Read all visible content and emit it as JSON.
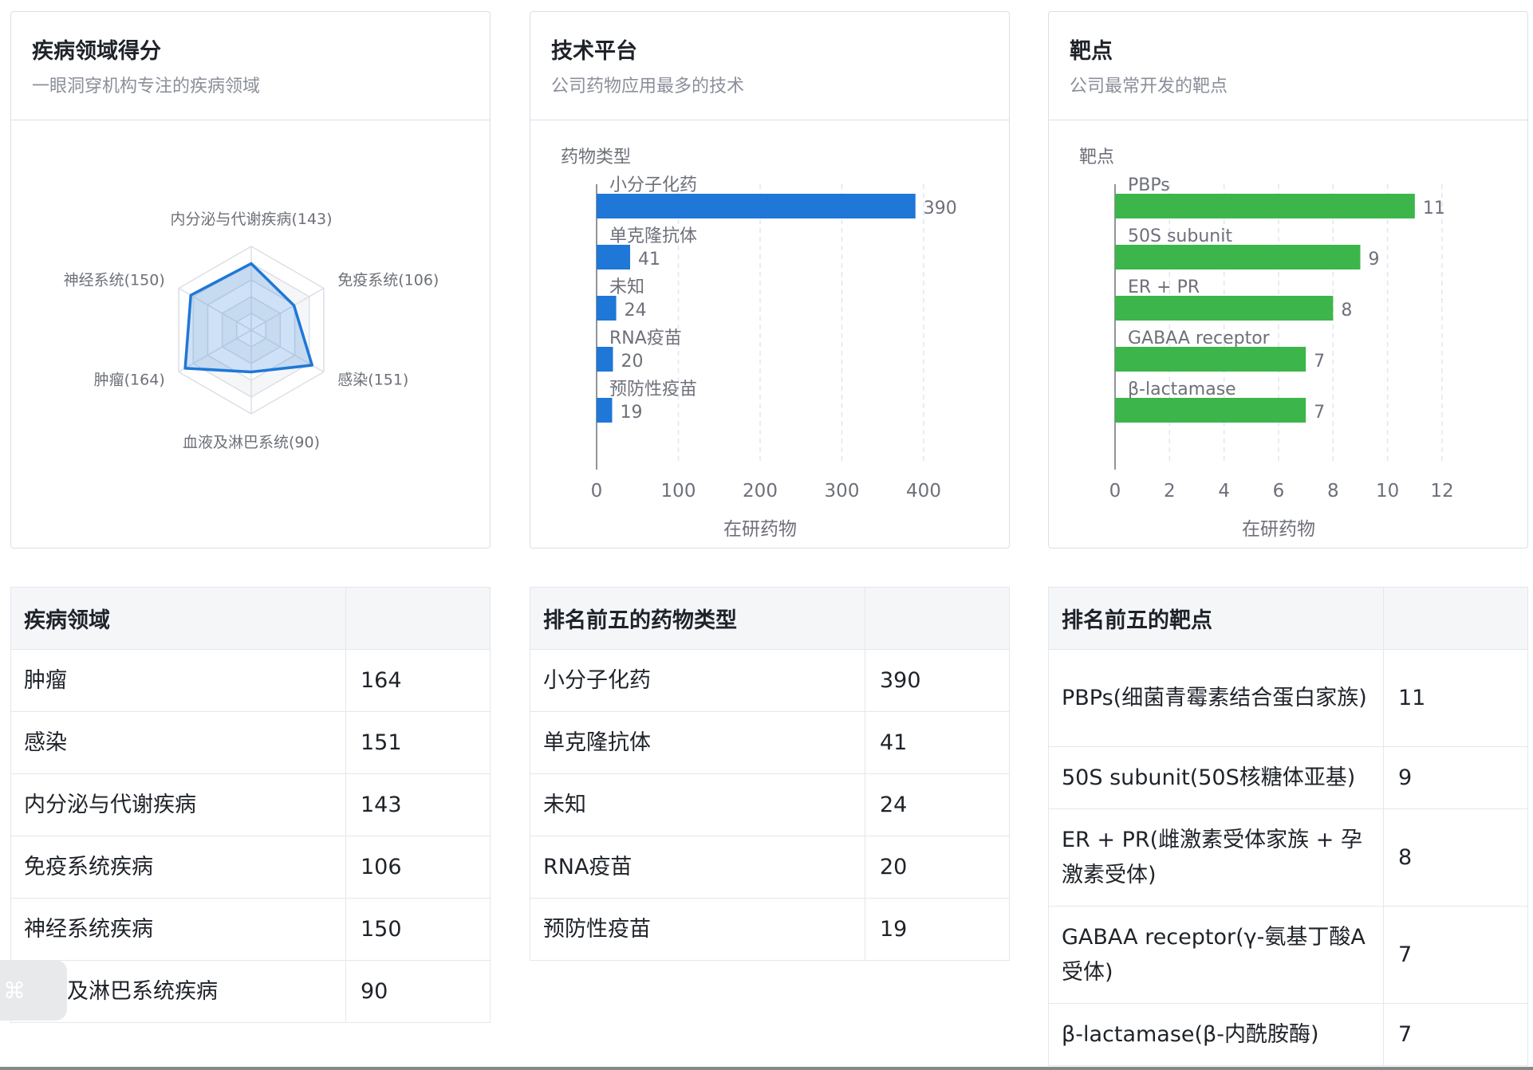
{
  "cards": [
    {
      "title": "疾病领域得分",
      "subtitle": "一眼洞穿机构专注的疾病领域"
    },
    {
      "title": "技术平台",
      "subtitle": "公司药物应用最多的技术"
    },
    {
      "title": "靶点",
      "subtitle": "公司最常开发的靶点"
    }
  ],
  "chart_data": [
    {
      "type": "radar",
      "indicators": [
        {
          "label": "内分泌与代谢疾病(143)",
          "value": 143
        },
        {
          "label": "免疫系统(106)",
          "value": 106
        },
        {
          "label": "感染(151)",
          "value": 151
        },
        {
          "label": "血液及淋巴系统(90)",
          "value": 90
        },
        {
          "label": "肿瘤(164)",
          "value": 164
        },
        {
          "label": "神经系统(150)",
          "value": 150
        }
      ],
      "max": 180,
      "rings": 5,
      "color": "#1f77d8",
      "fill": "rgba(31,119,216,0.22)"
    },
    {
      "type": "bar",
      "orientation": "horizontal",
      "ylabel": "药物类型",
      "xlabel": "在研药物",
      "categories": [
        "小分子化药",
        "单克隆抗体",
        "未知",
        "RNA疫苗",
        "预防性疫苗"
      ],
      "values": [
        390,
        41,
        24,
        20,
        19
      ],
      "xlim": [
        0,
        400
      ],
      "xticks": [
        "0",
        "100",
        "200",
        "300",
        "400"
      ],
      "grid": "dashed-vertical",
      "color": "#1f77d8"
    },
    {
      "type": "bar",
      "orientation": "horizontal",
      "ylabel": "靶点",
      "xlabel": "在研药物",
      "categories": [
        "PBPs",
        "50S subunit",
        "ER + PR",
        "GABAA receptor",
        "β-lactamase"
      ],
      "values": [
        11,
        9,
        8,
        7,
        7
      ],
      "xlim": [
        0,
        12
      ],
      "xticks": [
        "0",
        "2",
        "4",
        "6",
        "8",
        "10",
        "12"
      ],
      "grid": "dashed-vertical",
      "color": "#3cb54a"
    }
  ],
  "tables": [
    {
      "header": "疾病领域",
      "rows": [
        {
          "name": "肿瘤",
          "value": "164"
        },
        {
          "name": "感染",
          "value": "151"
        },
        {
          "name": "内分泌与代谢疾病",
          "value": "143"
        },
        {
          "name": "免疫系统疾病",
          "value": "106"
        },
        {
          "name": "神经系统疾病",
          "value": "150"
        },
        {
          "name": "血液及淋巴系统疾病",
          "value": "90"
        }
      ]
    },
    {
      "header": "排名前五的药物类型",
      "rows": [
        {
          "name": "小分子化药",
          "value": "390"
        },
        {
          "name": "单克隆抗体",
          "value": "41"
        },
        {
          "name": "未知",
          "value": "24"
        },
        {
          "name": "RNA疫苗",
          "value": "20"
        },
        {
          "name": "预防性疫苗",
          "value": "19"
        }
      ]
    },
    {
      "header": "排名前五的靶点",
      "rows": [
        {
          "name": "PBPs(细菌青霉素结合蛋白家族)",
          "value": "11"
        },
        {
          "name": "50S subunit(50S核糖体亚基)",
          "value": "9"
        },
        {
          "name": "ER + PR(雌激素受体家族 + 孕激素受体)",
          "value": "8"
        },
        {
          "name": "GABAA receptor(γ-氨基丁酸A受体)",
          "value": "7"
        },
        {
          "name": "β-lactamase(β-内酰胺酶)",
          "value": "7"
        }
      ]
    }
  ],
  "float_button": {
    "icon": "command-icon",
    "glyph": "⌘"
  }
}
